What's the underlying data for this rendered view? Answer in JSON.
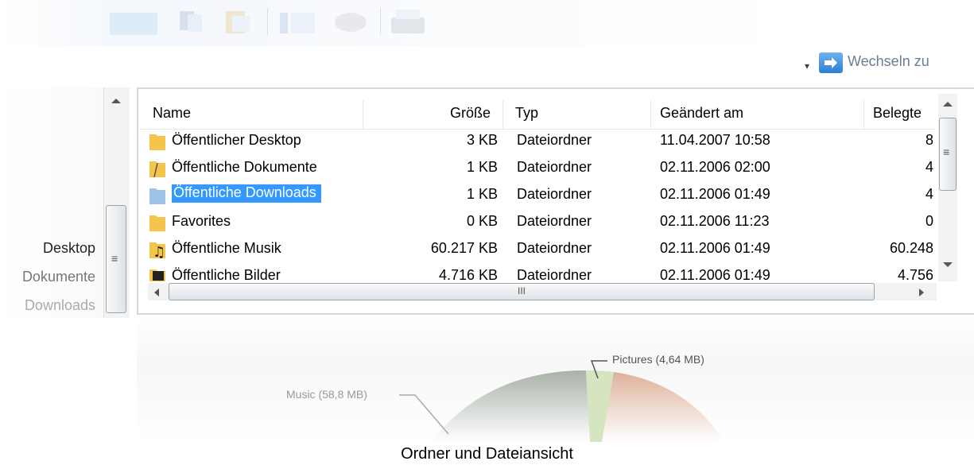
{
  "toolbar": {
    "icons": [
      "copy-icon",
      "paste-icon",
      "folder-view-icon",
      "share-icon",
      "print-icon"
    ]
  },
  "switchbar": {
    "dropdown_glyph": "▾",
    "switch_label": "Wechseln zu"
  },
  "nav": {
    "items": [
      "Desktop",
      "Dokumente",
      "Downloads"
    ]
  },
  "columns": {
    "name": "Name",
    "size": "Größe",
    "type": "Typ",
    "modified": "Geändert am",
    "used": "Belegte"
  },
  "rows": [
    {
      "name": "Öffentlicher Desktop",
      "size": "3 KB",
      "type": "Dateiordner",
      "modified": "11.04.2007 10:58",
      "used": "8",
      "icon": "folder-icon",
      "selected": false
    },
    {
      "name": "Öffentliche Dokumente",
      "size": "1 KB",
      "type": "Dateiordner",
      "modified": "02.11.2006 02:00",
      "used": "4",
      "icon": "documents-folder-icon",
      "selected": false
    },
    {
      "name": "Öffentliche Downloads",
      "size": "1 KB",
      "type": "Dateiordner",
      "modified": "02.11.2006 01:49",
      "used": "4",
      "icon": "downloads-folder-icon",
      "selected": true
    },
    {
      "name": "Favorites",
      "size": "0 KB",
      "type": "Dateiordner",
      "modified": "02.11.2006 11:23",
      "used": "0",
      "icon": "folder-icon",
      "selected": false
    },
    {
      "name": "Öffentliche Musik",
      "size": "60.217 KB",
      "type": "Dateiordner",
      "modified": "02.11.2006 01:49",
      "used": "60.248",
      "icon": "music-folder-icon",
      "selected": false
    },
    {
      "name": "Öffentliche Bilder",
      "size": "4.716 KB",
      "type": "Dateiordner",
      "modified": "02.11.2006 01:49",
      "used": "4.756",
      "icon": "pictures-folder-icon",
      "selected": false
    }
  ],
  "scrollbar": {
    "h_grip": "III",
    "v_grip": "≡"
  },
  "chart": {
    "labels": {
      "music": "Music (58,8 MB)",
      "pictures": "Pictures (4,64 MB)"
    }
  },
  "caption": "Ordner und Dateiansicht",
  "colors": {
    "selection": "#3399ff",
    "folder": "#f3c54a",
    "accent": "#3a8ee6"
  }
}
